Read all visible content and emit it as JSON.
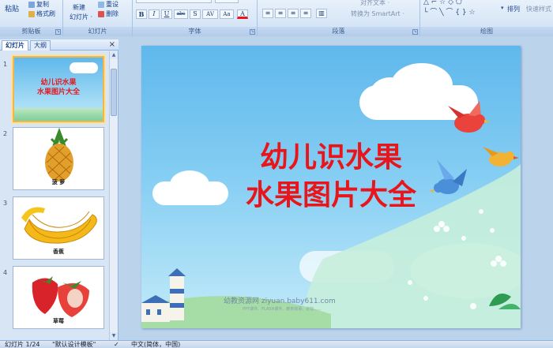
{
  "ribbon": {
    "clipboard": {
      "paste": "粘贴",
      "copy": "复制",
      "format_painter": "格式刷",
      "label": "剪贴板"
    },
    "slides": {
      "new_slide_l1": "新建",
      "new_slide_l2": "幻灯片 ·",
      "reset": "重设",
      "delete": "删除",
      "label": "幻灯片"
    },
    "font": {
      "bold": "B",
      "italic": "I",
      "underline": "U",
      "strike": "abc",
      "shadow": "S",
      "spacing": "AV",
      "case": "Aa",
      "color": "A",
      "label": "字体"
    },
    "paragraph": {
      "align_text": "对齐文本 ·",
      "smartart": "转换为 SmartArt ·",
      "label": "段落"
    },
    "drawing": {
      "arrange": "排列",
      "quick_styles": "快速样式",
      "label": "绘图"
    }
  },
  "pane": {
    "tabs": [
      "幻灯片",
      "大纲"
    ],
    "close": "×",
    "slides": [
      {
        "num": "1",
        "title1": "幼儿识水果",
        "title2": "水果图片大全"
      },
      {
        "num": "2",
        "caption": "菠 萝"
      },
      {
        "num": "3",
        "caption": "香蕉"
      },
      {
        "num": "4",
        "caption": "草莓"
      }
    ]
  },
  "slide": {
    "title_line1": "幼儿识水果",
    "title_line2": "水果图片大全",
    "watermark": "幼教资源网 ziyuan.baby611.com",
    "watermark_sub": "PPT课件、FLASH课件、教育故事、论坛......"
  },
  "status": {
    "slide_pos": "幻灯片 1/24",
    "theme": "\"默认设计模板\"",
    "language": "中文(简体，中国)"
  },
  "colors": {
    "title_red": "#e8161b",
    "ribbon_blue": "#15428b",
    "sky": "#5fb8ec"
  }
}
